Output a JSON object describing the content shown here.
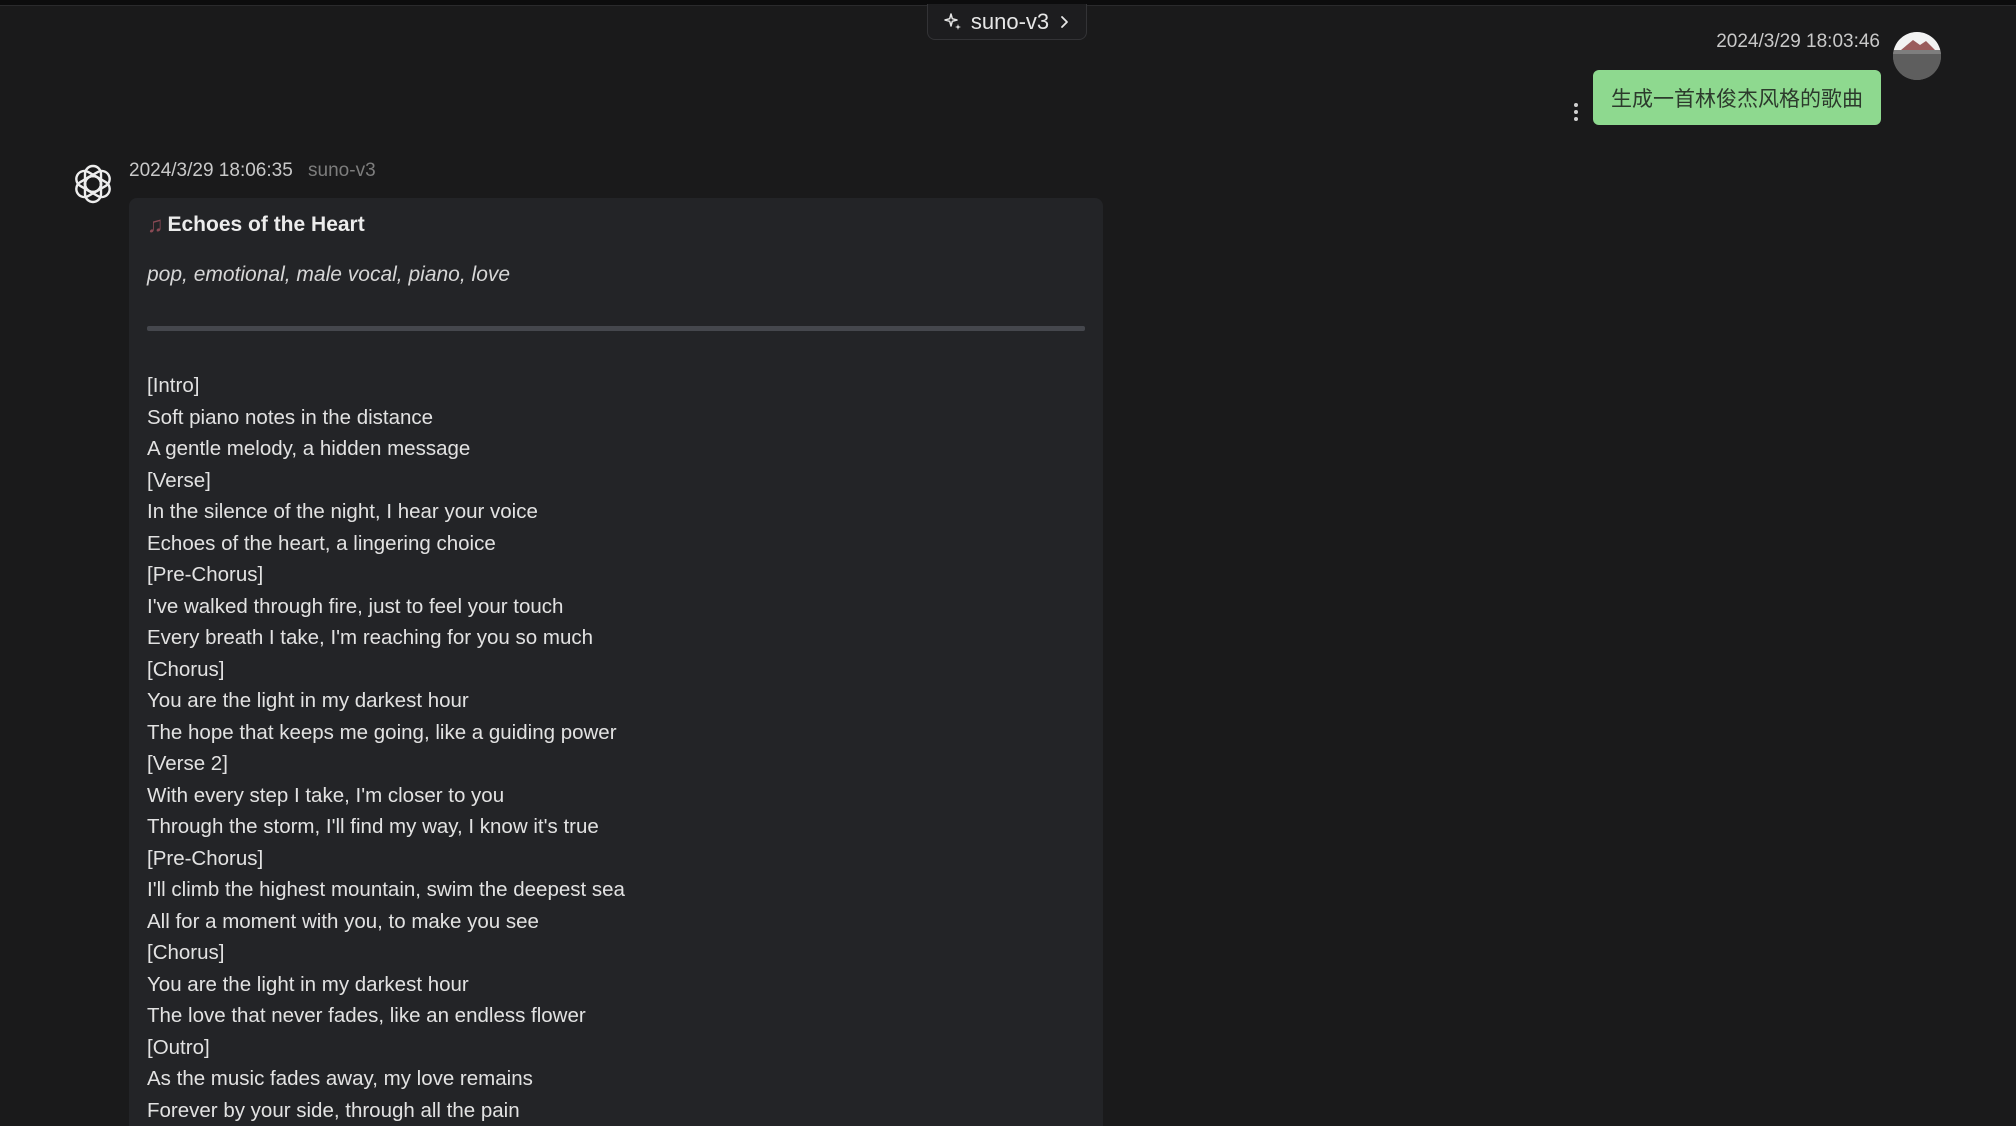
{
  "header": {
    "model_chip_label": "suno-v3"
  },
  "user_message": {
    "timestamp": "2024/3/29 18:03:46",
    "text": "生成一首林俊杰风格的歌曲"
  },
  "bot_message": {
    "timestamp": "2024/3/29 18:06:35",
    "model": "suno-v3",
    "song": {
      "title": "Echoes of the Heart",
      "tags": "pop, emotional, male vocal, piano, love",
      "lyrics": [
        "[Intro]",
        "Soft piano notes in the distance",
        "A gentle melody, a hidden message",
        "[Verse]",
        "In the silence of the night, I hear your voice",
        "Echoes of the heart, a lingering choice",
        "[Pre-Chorus]",
        "I've walked through fire, just to feel your touch",
        "Every breath I take, I'm reaching for you so much",
        "[Chorus]",
        "You are the light in my darkest hour",
        "The hope that keeps me going, like a guiding power",
        "[Verse 2]",
        "With every step I take, I'm closer to you",
        "Through the storm, I'll find my way, I know it's true",
        "[Pre-Chorus]",
        "I'll climb the highest mountain, swim the deepest sea",
        "All for a moment with you, to make you see",
        "[Chorus]",
        "You are the light in my darkest hour",
        "The love that never fades, like an endless flower",
        "[Outro]",
        "As the music fades away, my love remains",
        "Forever by your side, through all the pain"
      ]
    }
  },
  "colors": {
    "background": "#1a1a1b",
    "card": "#232427",
    "user_bubble": "#8ed98f",
    "divider": "#45474d"
  },
  "icons": {
    "model_chip": "sparkle-icon",
    "chip_arrow": "chevron-right-icon",
    "bot_avatar": "openai-logo-icon",
    "song_title": "music-note-icon",
    "menu": "more-vertical-icon"
  }
}
